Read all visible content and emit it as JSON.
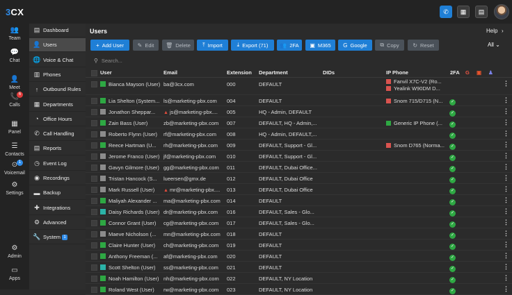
{
  "app": {
    "logo_brand": "3",
    "logo_rest": "CX"
  },
  "rail": [
    {
      "label": "Team",
      "icon": "team-icon",
      "glyph": "👥",
      "badge": ""
    },
    {
      "label": "Chat",
      "icon": "chat-icon",
      "glyph": "💬",
      "badge": ""
    },
    {
      "label": "Meet",
      "icon": "meet-icon",
      "glyph": "👤",
      "badge": ""
    },
    {
      "label": "Calls",
      "icon": "calls-icon",
      "glyph": "📞",
      "badge": "6",
      "badge_color": "#e03b3b"
    },
    {
      "label": "Panel",
      "icon": "panel-icon",
      "glyph": "▦",
      "badge": ""
    },
    {
      "label": "Contacts",
      "icon": "contacts-icon",
      "glyph": "☰",
      "badge": ""
    },
    {
      "label": "Voicemail",
      "icon": "voicemail-icon",
      "glyph": "⊙",
      "badge": "1",
      "badge_color": "#2f8be8"
    },
    {
      "label": "Settings",
      "icon": "settings-icon",
      "glyph": "⚙",
      "badge": ""
    },
    {
      "label": "Admin",
      "icon": "admin-icon",
      "glyph": "⚙",
      "badge": ""
    },
    {
      "label": "Apps",
      "icon": "apps-icon",
      "glyph": "▭",
      "badge": ""
    }
  ],
  "menu": [
    {
      "label": "Dashboard",
      "icon": "dashboard-icon",
      "glyph": "▤"
    },
    {
      "label": "Users",
      "icon": "users-icon",
      "glyph": "👤",
      "active": true
    },
    {
      "label": "Voice & Chat",
      "icon": "voice-chat-icon",
      "glyph": "🌐"
    },
    {
      "label": "Phones",
      "icon": "phones-icon",
      "glyph": "▥"
    },
    {
      "label": "Outbound Rules",
      "icon": "outbound-rules-icon",
      "glyph": "↑"
    },
    {
      "label": "Departments",
      "icon": "departments-icon",
      "glyph": "▦"
    },
    {
      "label": "Office Hours",
      "icon": "office-hours-icon",
      "glyph": "◔"
    },
    {
      "label": "Call Handling",
      "icon": "call-handling-icon",
      "glyph": "✆"
    },
    {
      "label": "Reports",
      "icon": "reports-icon",
      "glyph": "▤"
    },
    {
      "label": "Event Log",
      "icon": "event-log-icon",
      "glyph": "◷"
    },
    {
      "label": "Recordings",
      "icon": "recordings-icon",
      "glyph": "◉"
    },
    {
      "label": "Backup",
      "icon": "backup-icon",
      "glyph": "▬"
    },
    {
      "label": "Integrations",
      "icon": "integrations-icon",
      "glyph": "✚"
    },
    {
      "label": "Advanced",
      "icon": "advanced-icon",
      "glyph": "⚙"
    },
    {
      "label": "System",
      "icon": "system-icon",
      "glyph": "🔧",
      "badge": "1"
    }
  ],
  "page": {
    "title": "Users",
    "help_label": "Help",
    "filter_selected": "All"
  },
  "toolbar": [
    {
      "label": "Add User",
      "glyph": "+",
      "style": "blue",
      "name": "add-user-button"
    },
    {
      "label": "Edit",
      "glyph": "✎",
      "style": "gray",
      "name": "edit-button"
    },
    {
      "label": "Delete",
      "glyph": "🗑",
      "style": "gray",
      "name": "delete-button"
    },
    {
      "label": "Import",
      "glyph": "⤒",
      "style": "blue",
      "name": "import-button"
    },
    {
      "label": "Export (71)",
      "glyph": "⤓",
      "style": "blue",
      "name": "export-button"
    },
    {
      "label": "2FA",
      "glyph": "👥",
      "style": "blue",
      "name": "two-fa-button"
    },
    {
      "label": "M365",
      "glyph": "▣",
      "style": "blue",
      "name": "m365-button"
    },
    {
      "label": "Google",
      "glyph": "G",
      "style": "blue",
      "name": "google-button"
    },
    {
      "label": "Copy",
      "glyph": "⧉",
      "style": "gray",
      "name": "copy-button"
    },
    {
      "label": "Reset",
      "glyph": "↻",
      "style": "gray",
      "name": "reset-button"
    }
  ],
  "search": {
    "placeholder": "Search..."
  },
  "columns": {
    "user": "User",
    "email": "Email",
    "extension": "Extension",
    "department": "Department",
    "dids": "DIDs",
    "ip_phone": "IP Phone",
    "twofa": "2FA"
  },
  "colors": {
    "green": "#2ea843",
    "gray": "#8c8c8c",
    "teal": "#2bb3a8",
    "red": "#d9534f"
  },
  "users": [
    {
      "name": "Bianca Mayson (User)",
      "status": "green",
      "email": "ba@3cx.com",
      "ext": "000",
      "dept": "DEFAULT",
      "phones": [
        {
          "text": "Fanvil X7C-V2 (Ro...",
          "color": "red"
        },
        {
          "text": "Yealink W90DM D...",
          "color": "red"
        }
      ],
      "twofa": false
    },
    {
      "name": "Lia Shelton (System...",
      "status": "green",
      "email": "ls@marketing-pbx.com",
      "ext": "004",
      "dept": "DEFAULT",
      "phones": [
        {
          "text": "Snom 715/D715 (N...",
          "color": "red"
        }
      ],
      "twofa": true
    },
    {
      "name": "Jonathon Sheppar...",
      "status": "gray",
      "email": "js@marketing-pbx....",
      "warn": true,
      "ext": "005",
      "dept": "HQ - Admin, DEFAULT",
      "phones": [],
      "twofa": true
    },
    {
      "name": "Zain Bass (User)",
      "status": "green",
      "email": "zb@marketing-pbx.com",
      "ext": "007",
      "dept": "DEFAULT, HQ - Admin,...",
      "phones": [
        {
          "text": "Generic IP Phone (...",
          "color": "green"
        }
      ],
      "twofa": true
    },
    {
      "name": "Roberto Flynn (User)",
      "status": "gray",
      "email": "rf@marketing-pbx.com",
      "ext": "008",
      "dept": "HQ - Admin, DEFAULT,...",
      "phones": [],
      "twofa": true
    },
    {
      "name": "Reece Hartman (U...",
      "status": "green",
      "email": "rh@marketing-pbx.com",
      "ext": "009",
      "dept": "DEFAULT, Support - Gl...",
      "phones": [
        {
          "text": "Snom D765 (Norma...",
          "color": "red"
        }
      ],
      "twofa": true
    },
    {
      "name": "Jerome Franco (User)",
      "status": "gray",
      "email": "jf@marketing-pbx.com",
      "ext": "010",
      "dept": "DEFAULT, Support - Gl...",
      "phones": [],
      "twofa": true
    },
    {
      "name": "Gavyn Gilmore (User)",
      "status": "gray",
      "email": "gg@marketing-pbx.com",
      "ext": "011",
      "dept": "DEFAULT, Dubai Office...",
      "phones": [],
      "twofa": true
    },
    {
      "name": "Tristan Hancock (S...",
      "status": "gray",
      "email": "lueersen@gmx.de",
      "ext": "012",
      "dept": "DEFAULT, Dubai Office",
      "phones": [],
      "twofa": true
    },
    {
      "name": "Mark Russell (User)",
      "status": "gray",
      "email": "mr@marketing-pbx....",
      "warn": true,
      "ext": "013",
      "dept": "DEFAULT, Dubai Office",
      "phones": [],
      "twofa": true
    },
    {
      "name": "Maliyah Alexander ...",
      "status": "green",
      "email": "ma@marketing-pbx.com",
      "ext": "014",
      "dept": "DEFAULT",
      "phones": [],
      "twofa": true
    },
    {
      "name": "Daisy Richards (User)",
      "status": "teal",
      "email": "dr@marketing-pbx.com",
      "ext": "016",
      "dept": "DEFAULT, Sales - Glo...",
      "phones": [],
      "twofa": true
    },
    {
      "name": "Connor Grant (User)",
      "status": "green",
      "email": "cg@marketing-pbx.com",
      "ext": "017",
      "dept": "DEFAULT, Sales - Glo...",
      "phones": [],
      "twofa": true
    },
    {
      "name": "Maeve Nicholson (...",
      "status": "gray",
      "email": "mn@marketing-pbx.com",
      "ext": "018",
      "dept": "DEFAULT",
      "phones": [],
      "twofa": true
    },
    {
      "name": "Claire Hunter (User)",
      "status": "green",
      "email": "ch@marketing-pbx.com",
      "ext": "019",
      "dept": "DEFAULT",
      "phones": [],
      "twofa": true
    },
    {
      "name": "Anthony Freeman (...",
      "status": "green",
      "email": "af@marketing-pbx.com",
      "ext": "020",
      "dept": "DEFAULT",
      "phones": [],
      "twofa": true
    },
    {
      "name": "Scott Shelton (User)",
      "status": "teal",
      "email": "ss@marketing-pbx.com",
      "ext": "021",
      "dept": "DEFAULT",
      "phones": [],
      "twofa": true
    },
    {
      "name": "Noah Hamilton (User)",
      "status": "green",
      "email": "nh@marketing-pbx.com",
      "ext": "022",
      "dept": "DEFAULT, NY Location",
      "phones": [],
      "twofa": true
    },
    {
      "name": "Roland West (User)",
      "status": "green",
      "email": "rw@marketing-pbx.com",
      "ext": "023",
      "dept": "DEFAULT, NY Location",
      "phones": [],
      "twofa": true
    }
  ]
}
